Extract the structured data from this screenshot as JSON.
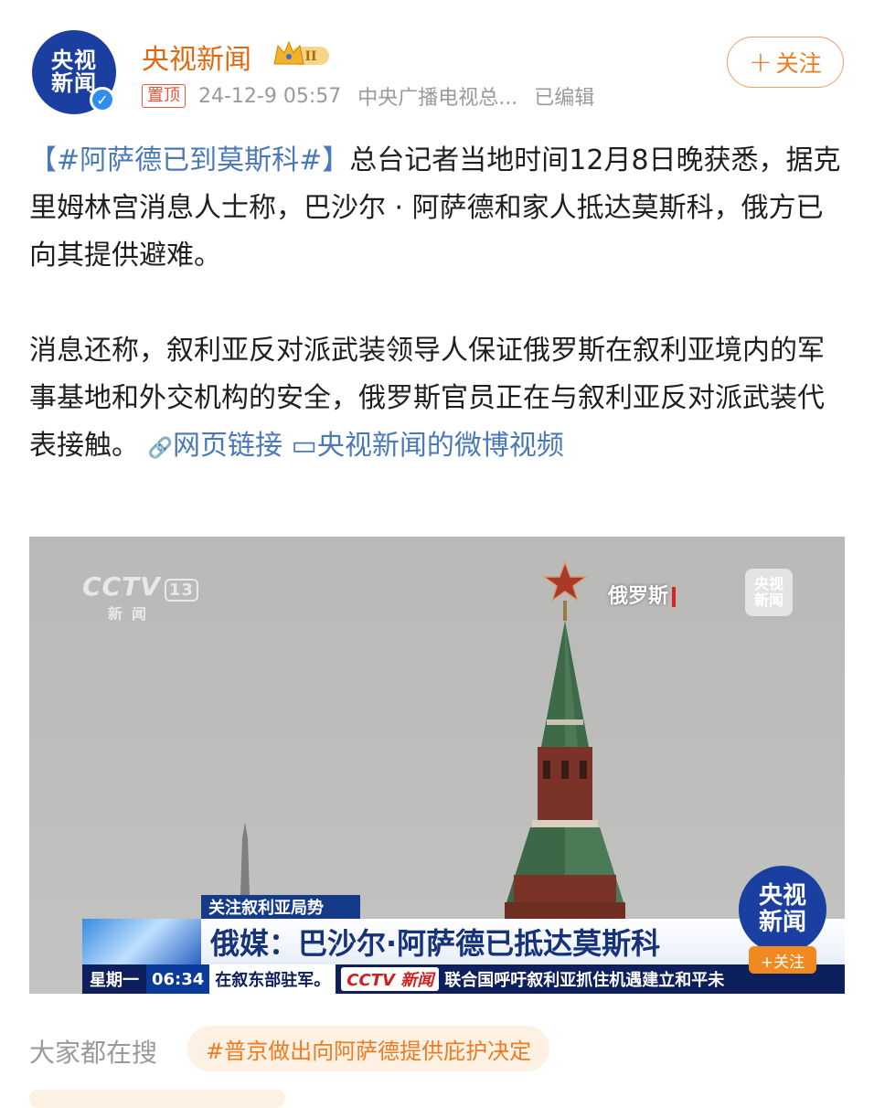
{
  "header": {
    "avatar_line1": "央视",
    "avatar_line2": "新闻",
    "verified_icon": "✓",
    "account_name": "央视新闻",
    "pinned_label": "置顶",
    "timestamp": "24-12-9 05:57",
    "source": "中央广播电视总...",
    "edited_label": "已编辑",
    "follow_label": "关注",
    "follow_plus": "+"
  },
  "post": {
    "hashtag": "【#阿萨德已到莫斯科#】",
    "para1": "总台记者当地时间12月8日晚获悉，据克里姆林宫消息人士称，巴沙尔 · 阿萨德和家人抵达莫斯科，俄方已向其提供避难。",
    "para2": "消息还称，叙利亚反对派武装领导人保证俄罗斯在叙利亚境内的军事基地和外交机构的安全，俄罗斯官员正在与叙利亚反对派武装代表接触。",
    "web_link_icon": "🔗",
    "web_link_label": "网页链接",
    "video_link_icon": "▭",
    "video_link_label": "央视新闻的微博视频"
  },
  "video": {
    "channel_logo": "CCTV",
    "channel_num": "13",
    "channel_sub": "新闻",
    "location_tag": "俄罗斯",
    "watermark_small_l1": "央视",
    "watermark_small_l2": "新闻",
    "watermark_big_l1": "央视",
    "watermark_big_l2": "新闻",
    "watermark_follow": "+关注",
    "topic_strip": "关注叙利亚局势",
    "headline": "俄媒：巴沙尔·阿萨德已抵达莫斯科",
    "ticker_day": "星期一",
    "ticker_time": "06:34",
    "ticker_text1": "在叙东部驻军。",
    "ticker_channel": "CCTV 新闻",
    "ticker_text2": "联合国呼吁叙利亚抓住机遇建立和平未"
  },
  "search": {
    "label": "大家都在搜",
    "chip": "#普京做出向阿萨德提供庇护决定"
  },
  "colors": {
    "accent_orange": "#f07a20",
    "link_blue": "#4a79b8",
    "brand_blue": "#1a3fa0"
  }
}
